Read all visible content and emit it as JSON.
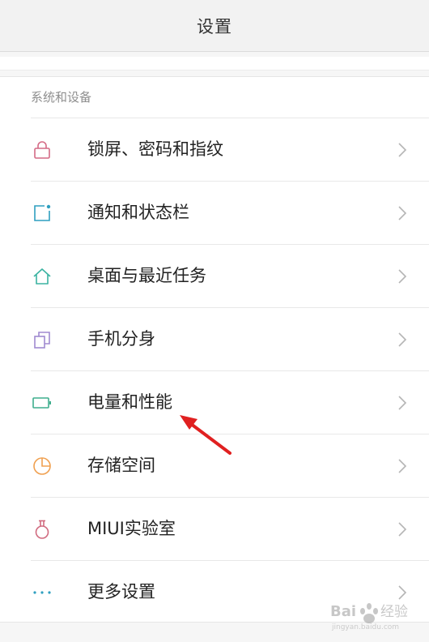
{
  "header": {
    "title": "设置"
  },
  "section": {
    "title": "系统和设备"
  },
  "items": [
    {
      "label": "锁屏、密码和指纹",
      "icon": "lock-icon"
    },
    {
      "label": "通知和状态栏",
      "icon": "notification-icon"
    },
    {
      "label": "桌面与最近任务",
      "icon": "home-icon"
    },
    {
      "label": "手机分身",
      "icon": "second-space-icon"
    },
    {
      "label": "电量和性能",
      "icon": "battery-icon"
    },
    {
      "label": "存储空间",
      "icon": "storage-icon"
    },
    {
      "label": "MIUI实验室",
      "icon": "lab-flask-icon"
    },
    {
      "label": "更多设置",
      "icon": "more-dots-icon"
    }
  ],
  "colors": {
    "lock": "#d46a85",
    "notification": "#2f9fc0",
    "home": "#3bb3a2",
    "second_space": "#a08ad0",
    "battery": "#3fae8e",
    "storage": "#f0a050",
    "lab": "#d06a7f",
    "more": "#2f9fc0",
    "annotation_arrow": "#e02020",
    "chevron": "#b5b5b5"
  },
  "watermark": {
    "text": "Bai du 经验"
  }
}
